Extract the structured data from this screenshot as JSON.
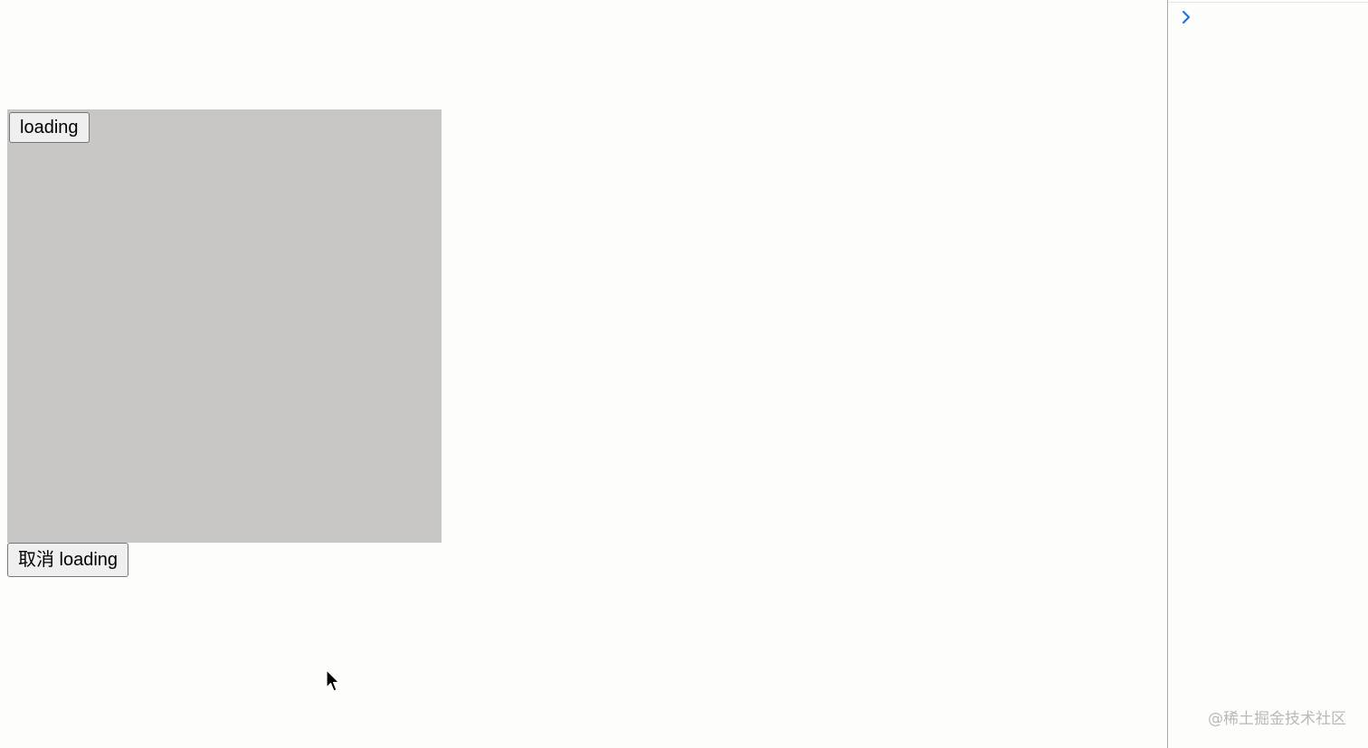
{
  "main": {
    "loading_button_label": "loading",
    "cancel_button_label": "取消 loading",
    "overlay_color": "#c8c7c5"
  },
  "devtools": {
    "prompt_icon": "chevron-right-icon",
    "accent_color": "#1a73e8"
  },
  "watermark": {
    "text": "@稀土掘金技术社区"
  }
}
